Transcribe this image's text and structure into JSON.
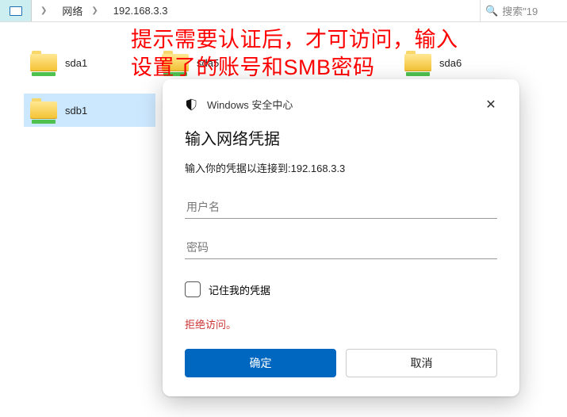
{
  "breadcrumb": {
    "network_label": "网络",
    "address": "192.168.3.3"
  },
  "search": {
    "placeholder": "搜索\"19"
  },
  "folders": [
    {
      "label": "sda1"
    },
    {
      "label": "sda5"
    },
    {
      "label": "sda6"
    },
    {
      "label": "sdb1"
    }
  ],
  "annotation": {
    "line1": "提示需要认证后，才可访问，输入",
    "line2": "设置了的账号和SMB密码"
  },
  "dialog": {
    "header": "Windows 安全中心",
    "title": "输入网络凭据",
    "prompt": "输入你的凭据以连接到:192.168.3.3",
    "username_placeholder": "用户名",
    "password_placeholder": "密码",
    "remember_label": "记住我的凭据",
    "error": "拒绝访问。",
    "ok_label": "确定",
    "cancel_label": "取消"
  }
}
